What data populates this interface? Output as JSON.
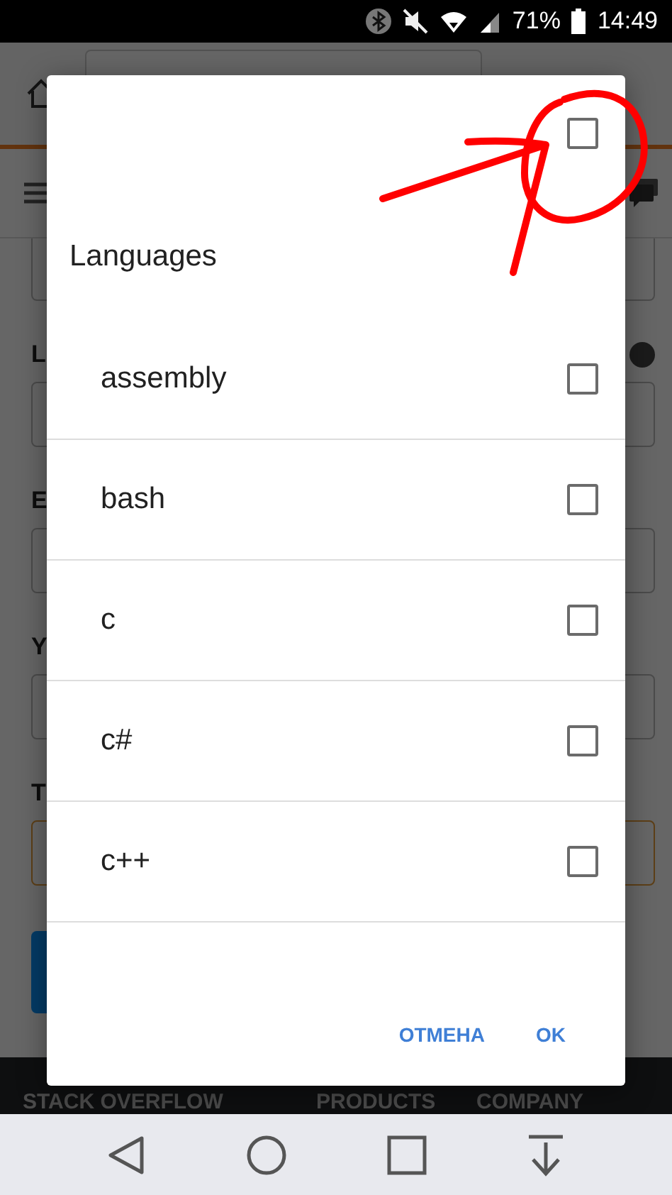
{
  "status_bar": {
    "battery_text": "71%",
    "time": "14:49"
  },
  "background_page": {
    "form_labels": [
      "L",
      "E",
      "Y",
      "T"
    ],
    "footer_links": [
      "STACK OVERFLOW",
      "PRODUCTS",
      "COMPANY"
    ]
  },
  "dialog": {
    "select_all_checked": false,
    "title": "Languages",
    "items": [
      {
        "label": "assembly",
        "checked": false
      },
      {
        "label": "bash",
        "checked": false
      },
      {
        "label": "c",
        "checked": false
      },
      {
        "label": "c#",
        "checked": false
      },
      {
        "label": "c++",
        "checked": false
      }
    ],
    "buttons": [
      "ОТМЕНА",
      "OK"
    ]
  }
}
